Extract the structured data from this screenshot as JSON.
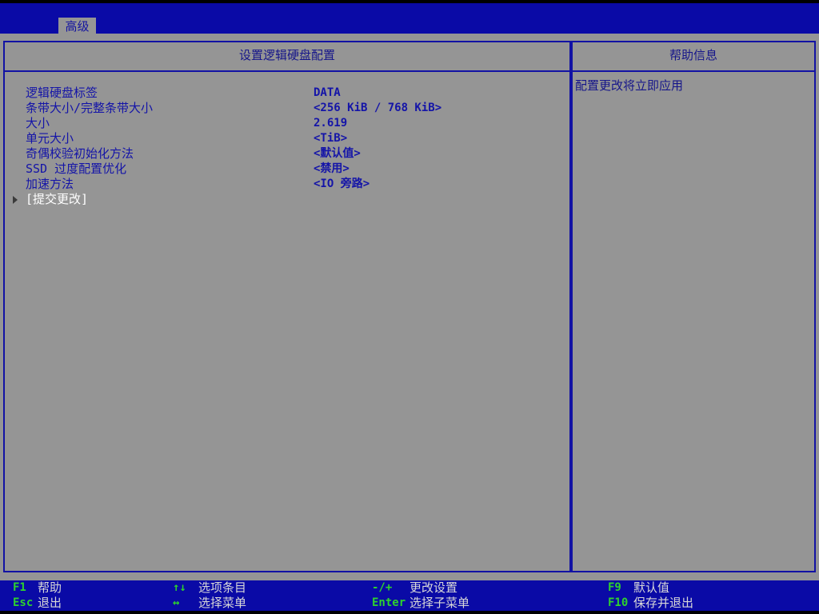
{
  "header": {
    "tab_label": "高级"
  },
  "left_panel": {
    "title": "设置逻辑硬盘配置",
    "settings": [
      {
        "label": "逻辑硬盘标签",
        "value": "DATA"
      },
      {
        "label": "条带大小/完整条带大小",
        "value": "<256 KiB / 768 KiB>"
      },
      {
        "label": "大小",
        "value": "2.619"
      },
      {
        "label": "单元大小",
        "value": "<TiB>"
      },
      {
        "label": "奇偶校验初始化方法",
        "value": "<默认值>"
      },
      {
        "label": "SSD 过度配置优化",
        "value": "<禁用>"
      },
      {
        "label": "加速方法",
        "value": "<IO 旁路>"
      }
    ],
    "submit_label": "[提交更改]"
  },
  "right_panel": {
    "title": "帮助信息",
    "help_text": "配置更改将立即应用"
  },
  "footer": {
    "keys": [
      {
        "key": "F1",
        "desc": "帮助"
      },
      {
        "key": "Esc",
        "desc": "退出"
      },
      {
        "key": "↑↓",
        "desc": "选项条目"
      },
      {
        "key": "↔",
        "desc": "选择菜单"
      },
      {
        "key": "-/+",
        "desc": "更改设置"
      },
      {
        "key": "Enter",
        "desc": "选择子菜单"
      },
      {
        "key": "F9",
        "desc": "默认值"
      },
      {
        "key": "F10",
        "desc": "保存并退出"
      }
    ]
  },
  "colors": {
    "bar_blue": "#0a0aa6",
    "panel_gray": "#959595",
    "text_blue": "#1414a8",
    "key_green": "#2ed12e"
  }
}
